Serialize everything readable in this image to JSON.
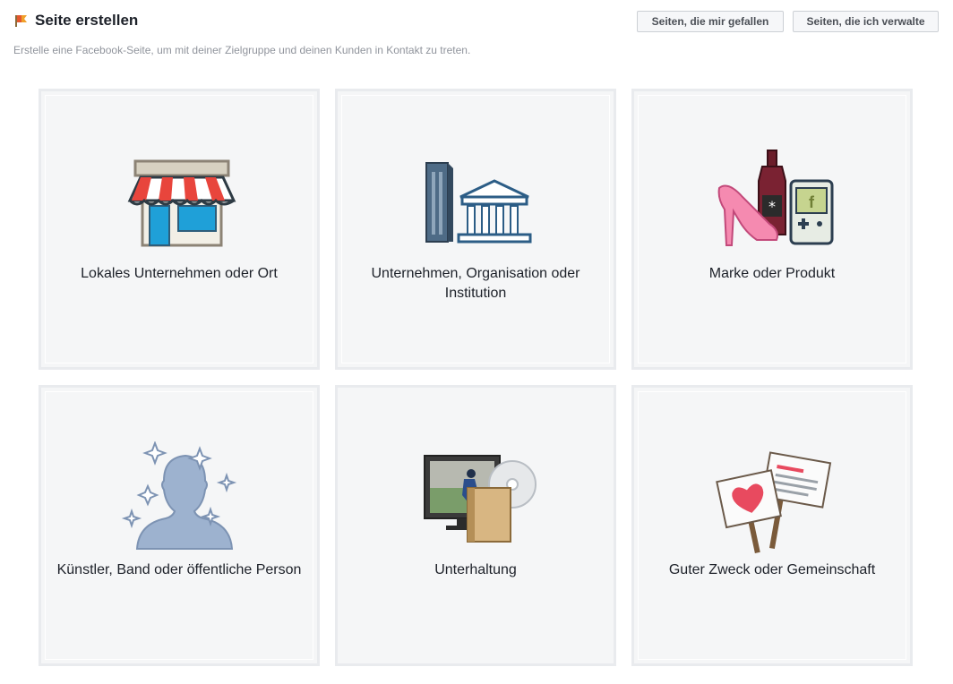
{
  "header": {
    "title": "Seite erstellen",
    "subtitle": "Erstelle eine Facebook-Seite, um mit deiner Zielgruppe und deinen Kunden in Kontakt zu treten.",
    "title_icon": "flag-icon"
  },
  "buttons": {
    "liked_pages": "Seiten, die mir gefallen",
    "managed_pages": "Seiten, die ich verwalte"
  },
  "categories": [
    {
      "label": "Lokales Unternehmen oder Ort",
      "icon": "storefront-icon"
    },
    {
      "label": "Unternehmen, Organisation oder Institution",
      "icon": "buildings-icon"
    },
    {
      "label": "Marke oder Produkt",
      "icon": "products-icon"
    },
    {
      "label": "Künstler, Band oder öffentliche Person",
      "icon": "public-figure-icon"
    },
    {
      "label": "Unterhaltung",
      "icon": "entertainment-icon"
    },
    {
      "label": "Guter Zweck oder Gemeinschaft",
      "icon": "cause-signs-icon"
    }
  ],
  "colors": {
    "tile_background": "#f5f6f7",
    "tile_border": "#e9ebee",
    "text": "#1d2129",
    "subtitle": "#90949c"
  }
}
